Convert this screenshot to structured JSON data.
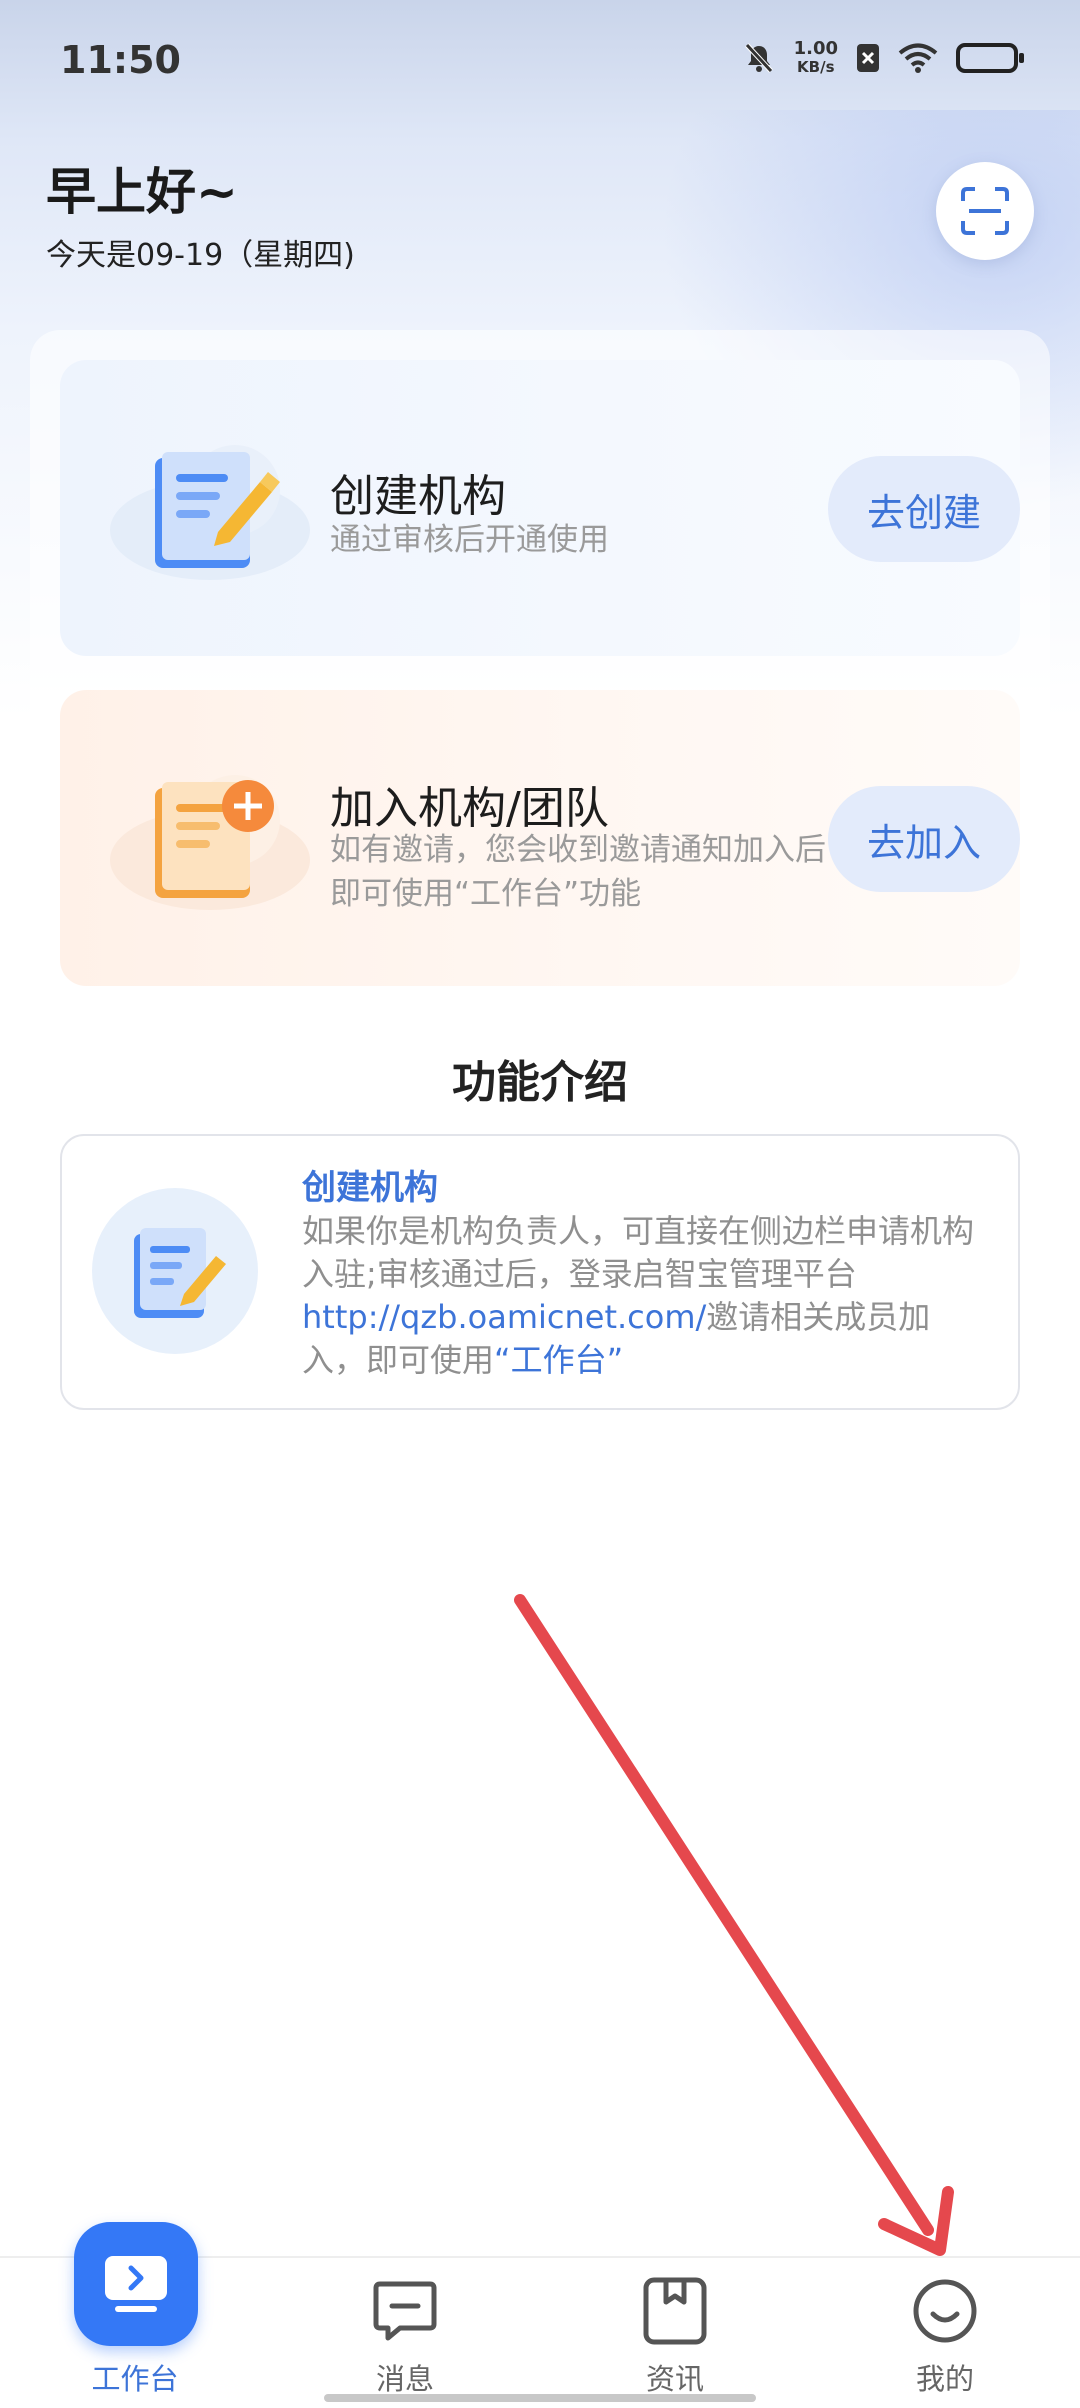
{
  "status_bar": {
    "time": "11:50",
    "net_speed_value": "1.00",
    "net_speed_unit": "KB/s",
    "icons": [
      "bell-mute-icon",
      "sim-off-icon",
      "wifi-icon",
      "battery-icon"
    ]
  },
  "header": {
    "greeting": "早上好~",
    "date_text": "今天是09-19（星期四)",
    "scan_icon": "scan-icon"
  },
  "cards": {
    "create": {
      "title": "创建机构",
      "desc": "通过审核后开通使用",
      "button": "去创建"
    },
    "join": {
      "title": "加入机构/团队",
      "desc": "如有邀请，您会收到邀请通知加入后即可使用“工作台”功能",
      "button": "去加入"
    }
  },
  "features": {
    "section_title": "功能介绍",
    "items": [
      {
        "title": "创建机构",
        "body_part1": "如果你是机构负责人，可直接在侧边栏申请机构入驻;审核通过后，登录启智宝管理平台",
        "link": "http://qzb.oamicnet.com/",
        "body_part2": "邀请相关成员加入，即可使用",
        "highlight": "“工作台”"
      }
    ]
  },
  "bottom_nav": {
    "active": "工作台",
    "items": [
      {
        "label": "工作台",
        "icon": "workbench-icon"
      },
      {
        "label": "消息",
        "icon": "message-icon"
      },
      {
        "label": "资讯",
        "icon": "news-icon"
      },
      {
        "label": "我的",
        "icon": "profile-icon"
      }
    ]
  },
  "colors": {
    "accent": "#3478f6",
    "link": "#3d74d8",
    "annotation_arrow": "#e5484d"
  }
}
